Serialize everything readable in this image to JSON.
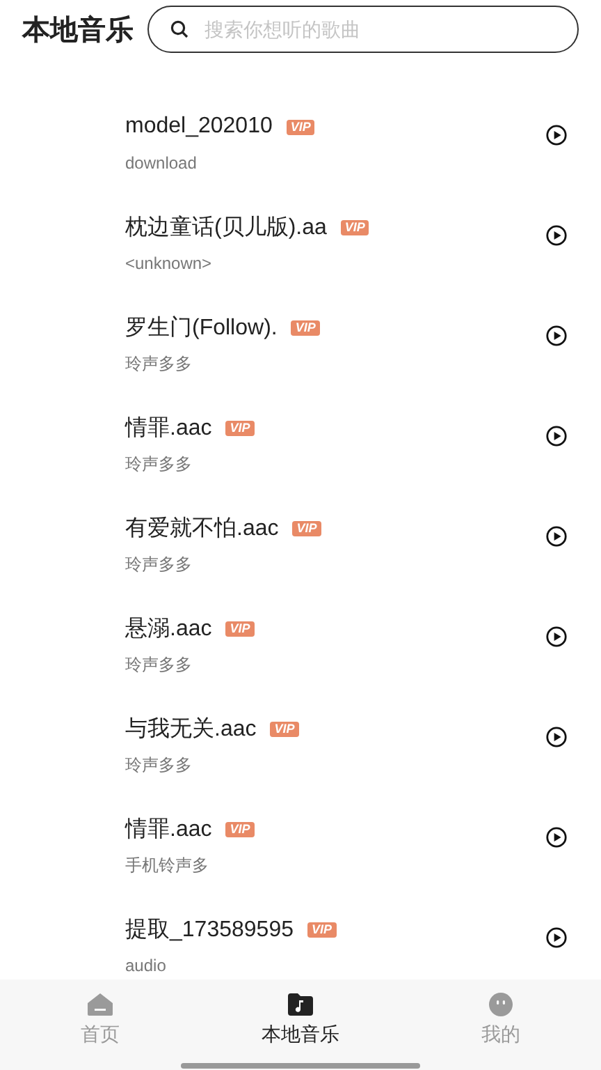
{
  "header": {
    "title": "本地音乐",
    "search": {
      "placeholder": "搜索你想听的歌曲"
    }
  },
  "songs": [
    {
      "title": "model_202010",
      "badge": "VIP",
      "subtitle": "download"
    },
    {
      "title": "枕边童话(贝儿版).aa",
      "badge": "VIP",
      "subtitle": "<unknown>"
    },
    {
      "title": "罗生门(Follow).",
      "badge": "VIP",
      "subtitle": "玲声多多"
    },
    {
      "title": "情罪.aac",
      "badge": "VIP",
      "subtitle": "玲声多多"
    },
    {
      "title": "有爱就不怕.aac",
      "badge": "VIP",
      "subtitle": "玲声多多"
    },
    {
      "title": "悬溺.aac",
      "badge": "VIP",
      "subtitle": "玲声多多"
    },
    {
      "title": "与我无关.aac",
      "badge": "VIP",
      "subtitle": "玲声多多"
    },
    {
      "title": "情罪.aac",
      "badge": "VIP",
      "subtitle": "手机铃声多"
    },
    {
      "title": "提取_173589595",
      "badge": "VIP",
      "subtitle": "audio"
    }
  ],
  "tab_bar": [
    {
      "kind": "home",
      "label": "首页",
      "selected": false
    },
    {
      "kind": "folder",
      "label": "本地音乐",
      "selected": true
    },
    {
      "kind": "face",
      "label": "我的",
      "selected": false
    }
  ]
}
